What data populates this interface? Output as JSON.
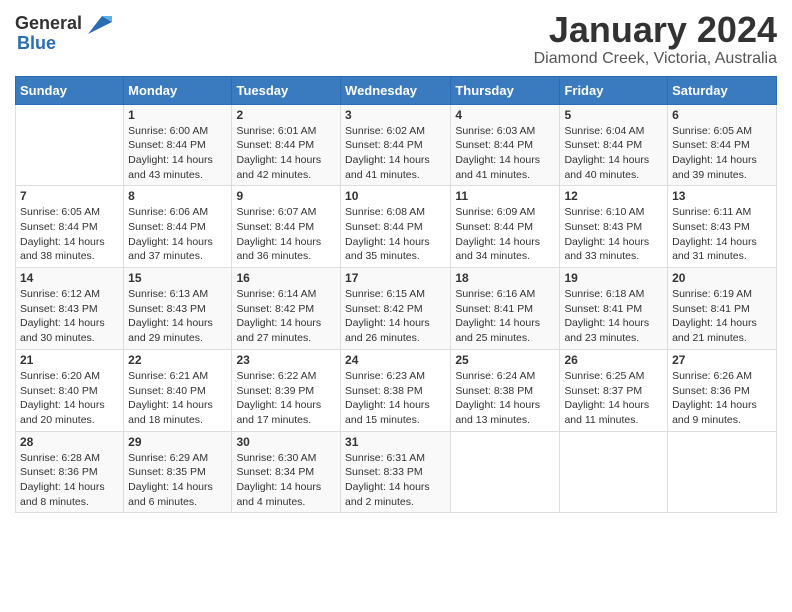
{
  "logo": {
    "general": "General",
    "blue": "Blue"
  },
  "title": "January 2024",
  "location": "Diamond Creek, Victoria, Australia",
  "days_header": [
    "Sunday",
    "Monday",
    "Tuesday",
    "Wednesday",
    "Thursday",
    "Friday",
    "Saturday"
  ],
  "weeks": [
    [
      {
        "num": "",
        "info": ""
      },
      {
        "num": "1",
        "info": "Sunrise: 6:00 AM\nSunset: 8:44 PM\nDaylight: 14 hours\nand 43 minutes."
      },
      {
        "num": "2",
        "info": "Sunrise: 6:01 AM\nSunset: 8:44 PM\nDaylight: 14 hours\nand 42 minutes."
      },
      {
        "num": "3",
        "info": "Sunrise: 6:02 AM\nSunset: 8:44 PM\nDaylight: 14 hours\nand 41 minutes."
      },
      {
        "num": "4",
        "info": "Sunrise: 6:03 AM\nSunset: 8:44 PM\nDaylight: 14 hours\nand 41 minutes."
      },
      {
        "num": "5",
        "info": "Sunrise: 6:04 AM\nSunset: 8:44 PM\nDaylight: 14 hours\nand 40 minutes."
      },
      {
        "num": "6",
        "info": "Sunrise: 6:05 AM\nSunset: 8:44 PM\nDaylight: 14 hours\nand 39 minutes."
      }
    ],
    [
      {
        "num": "7",
        "info": "Sunrise: 6:05 AM\nSunset: 8:44 PM\nDaylight: 14 hours\nand 38 minutes."
      },
      {
        "num": "8",
        "info": "Sunrise: 6:06 AM\nSunset: 8:44 PM\nDaylight: 14 hours\nand 37 minutes."
      },
      {
        "num": "9",
        "info": "Sunrise: 6:07 AM\nSunset: 8:44 PM\nDaylight: 14 hours\nand 36 minutes."
      },
      {
        "num": "10",
        "info": "Sunrise: 6:08 AM\nSunset: 8:44 PM\nDaylight: 14 hours\nand 35 minutes."
      },
      {
        "num": "11",
        "info": "Sunrise: 6:09 AM\nSunset: 8:44 PM\nDaylight: 14 hours\nand 34 minutes."
      },
      {
        "num": "12",
        "info": "Sunrise: 6:10 AM\nSunset: 8:43 PM\nDaylight: 14 hours\nand 33 minutes."
      },
      {
        "num": "13",
        "info": "Sunrise: 6:11 AM\nSunset: 8:43 PM\nDaylight: 14 hours\nand 31 minutes."
      }
    ],
    [
      {
        "num": "14",
        "info": "Sunrise: 6:12 AM\nSunset: 8:43 PM\nDaylight: 14 hours\nand 30 minutes."
      },
      {
        "num": "15",
        "info": "Sunrise: 6:13 AM\nSunset: 8:43 PM\nDaylight: 14 hours\nand 29 minutes."
      },
      {
        "num": "16",
        "info": "Sunrise: 6:14 AM\nSunset: 8:42 PM\nDaylight: 14 hours\nand 27 minutes."
      },
      {
        "num": "17",
        "info": "Sunrise: 6:15 AM\nSunset: 8:42 PM\nDaylight: 14 hours\nand 26 minutes."
      },
      {
        "num": "18",
        "info": "Sunrise: 6:16 AM\nSunset: 8:41 PM\nDaylight: 14 hours\nand 25 minutes."
      },
      {
        "num": "19",
        "info": "Sunrise: 6:18 AM\nSunset: 8:41 PM\nDaylight: 14 hours\nand 23 minutes."
      },
      {
        "num": "20",
        "info": "Sunrise: 6:19 AM\nSunset: 8:41 PM\nDaylight: 14 hours\nand 21 minutes."
      }
    ],
    [
      {
        "num": "21",
        "info": "Sunrise: 6:20 AM\nSunset: 8:40 PM\nDaylight: 14 hours\nand 20 minutes."
      },
      {
        "num": "22",
        "info": "Sunrise: 6:21 AM\nSunset: 8:40 PM\nDaylight: 14 hours\nand 18 minutes."
      },
      {
        "num": "23",
        "info": "Sunrise: 6:22 AM\nSunset: 8:39 PM\nDaylight: 14 hours\nand 17 minutes."
      },
      {
        "num": "24",
        "info": "Sunrise: 6:23 AM\nSunset: 8:38 PM\nDaylight: 14 hours\nand 15 minutes."
      },
      {
        "num": "25",
        "info": "Sunrise: 6:24 AM\nSunset: 8:38 PM\nDaylight: 14 hours\nand 13 minutes."
      },
      {
        "num": "26",
        "info": "Sunrise: 6:25 AM\nSunset: 8:37 PM\nDaylight: 14 hours\nand 11 minutes."
      },
      {
        "num": "27",
        "info": "Sunrise: 6:26 AM\nSunset: 8:36 PM\nDaylight: 14 hours\nand 9 minutes."
      }
    ],
    [
      {
        "num": "28",
        "info": "Sunrise: 6:28 AM\nSunset: 8:36 PM\nDaylight: 14 hours\nand 8 minutes."
      },
      {
        "num": "29",
        "info": "Sunrise: 6:29 AM\nSunset: 8:35 PM\nDaylight: 14 hours\nand 6 minutes."
      },
      {
        "num": "30",
        "info": "Sunrise: 6:30 AM\nSunset: 8:34 PM\nDaylight: 14 hours\nand 4 minutes."
      },
      {
        "num": "31",
        "info": "Sunrise: 6:31 AM\nSunset: 8:33 PM\nDaylight: 14 hours\nand 2 minutes."
      },
      {
        "num": "",
        "info": ""
      },
      {
        "num": "",
        "info": ""
      },
      {
        "num": "",
        "info": ""
      }
    ]
  ]
}
